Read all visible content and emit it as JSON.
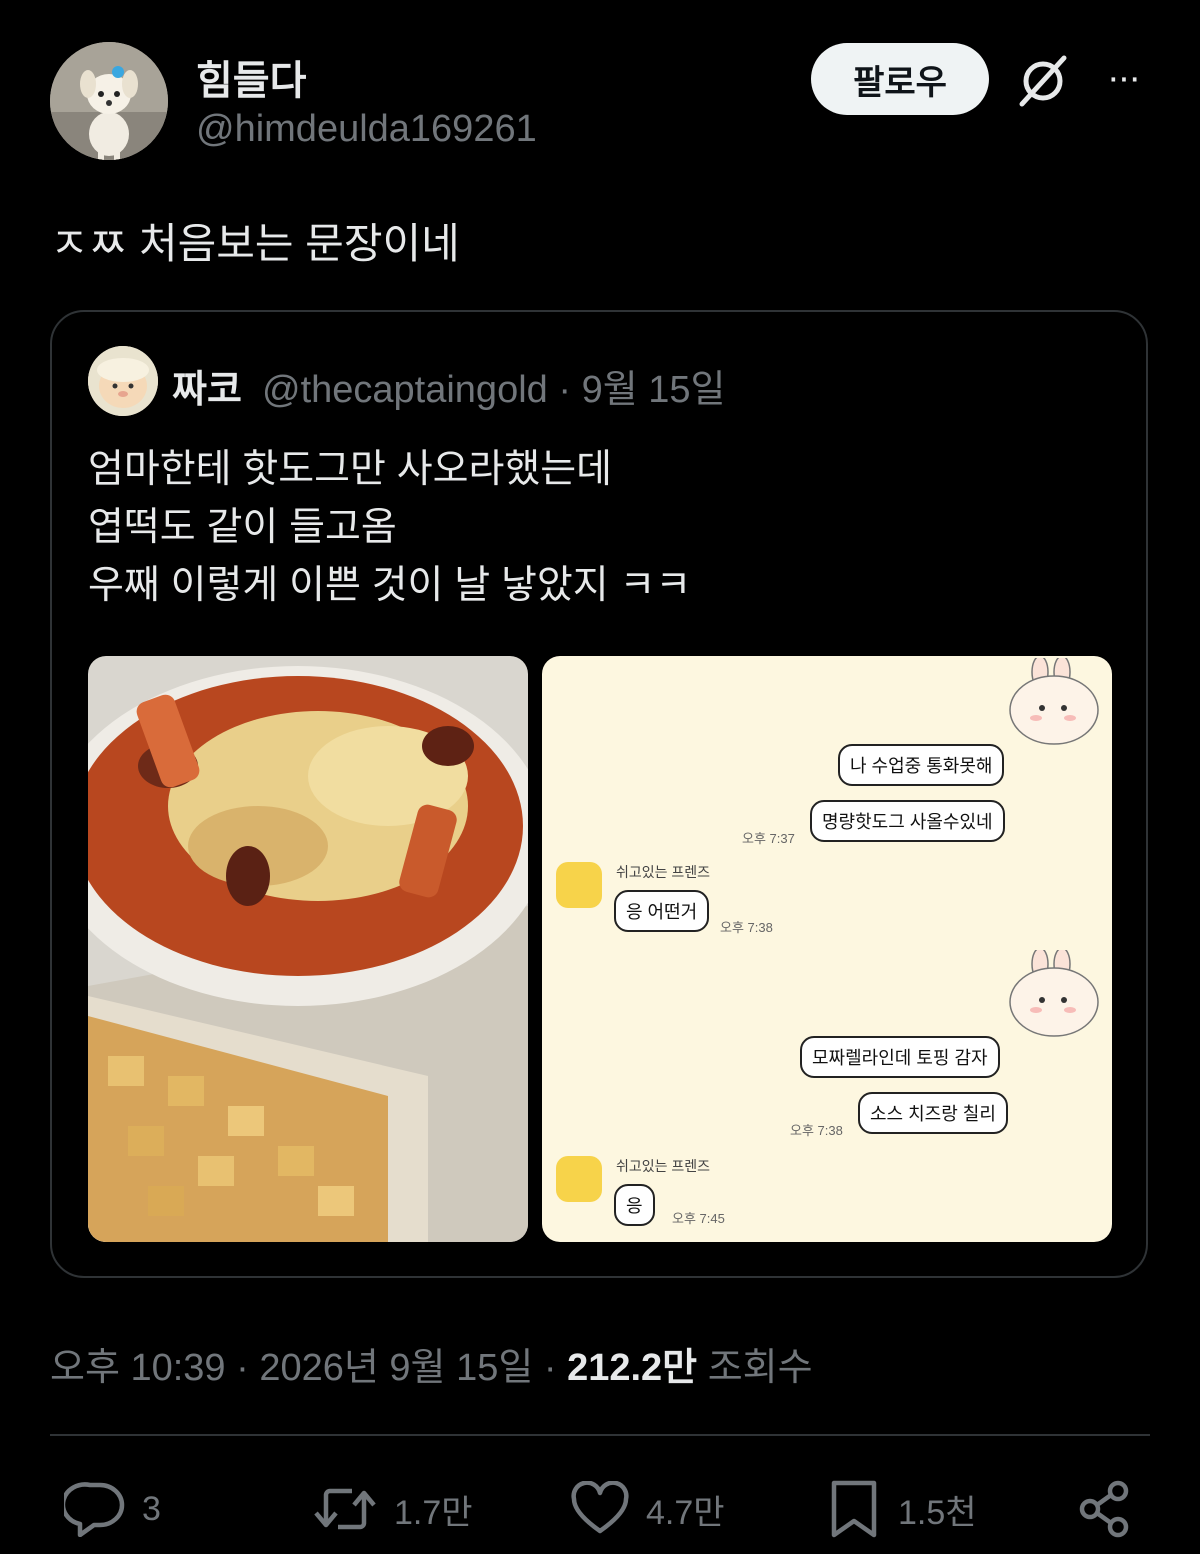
{
  "author": {
    "name": "힘들다",
    "handle": "@himdeulda169261"
  },
  "header": {
    "follow_label": "팔로우",
    "more_label": "···"
  },
  "tweet": {
    "text": "ㅈㅉ 처음보는 문장이네"
  },
  "quote": {
    "name": "짜코",
    "handle": "@thecaptaingold",
    "separator": " · ",
    "date": "9월 15일",
    "lines": [
      "엄마한테 핫도그만 사오라했는데",
      "엽떡도 같이 들고옴",
      "우째 이렇게 이쁜 것이 날 낳았지 ㅋㅋ"
    ]
  },
  "chat": {
    "msgs": [
      {
        "text": "나 수업중 통화못해"
      },
      {
        "text": "명량핫도그 사올수있네",
        "time": "오후 7:37"
      },
      {
        "sender": "쉬고있는 프렌즈",
        "text": "응 어떤거",
        "time": "오후 7:38"
      },
      {
        "text": "모짜렐라인데 토핑 감자"
      },
      {
        "text": "소스 치즈랑 칠리",
        "time": "오후 7:38"
      },
      {
        "sender": "쉬고있는 프렌즈",
        "text": "응",
        "time": "오후 7:45"
      }
    ]
  },
  "timestamp": {
    "time": "오후 10:39",
    "date": "2026년 9월 15일",
    "views": "212.2만",
    "views_label": "조회수",
    "sep": " · "
  },
  "actions": {
    "replies": "3",
    "reposts": "1.7만",
    "likes": "4.7만",
    "bookmarks": "1.5천"
  },
  "colors": {
    "background": "#000000",
    "text": "#e7e9ea",
    "secondary": "#71767b",
    "border": "#2f3336",
    "chat_bg": "#fdf7e0"
  }
}
